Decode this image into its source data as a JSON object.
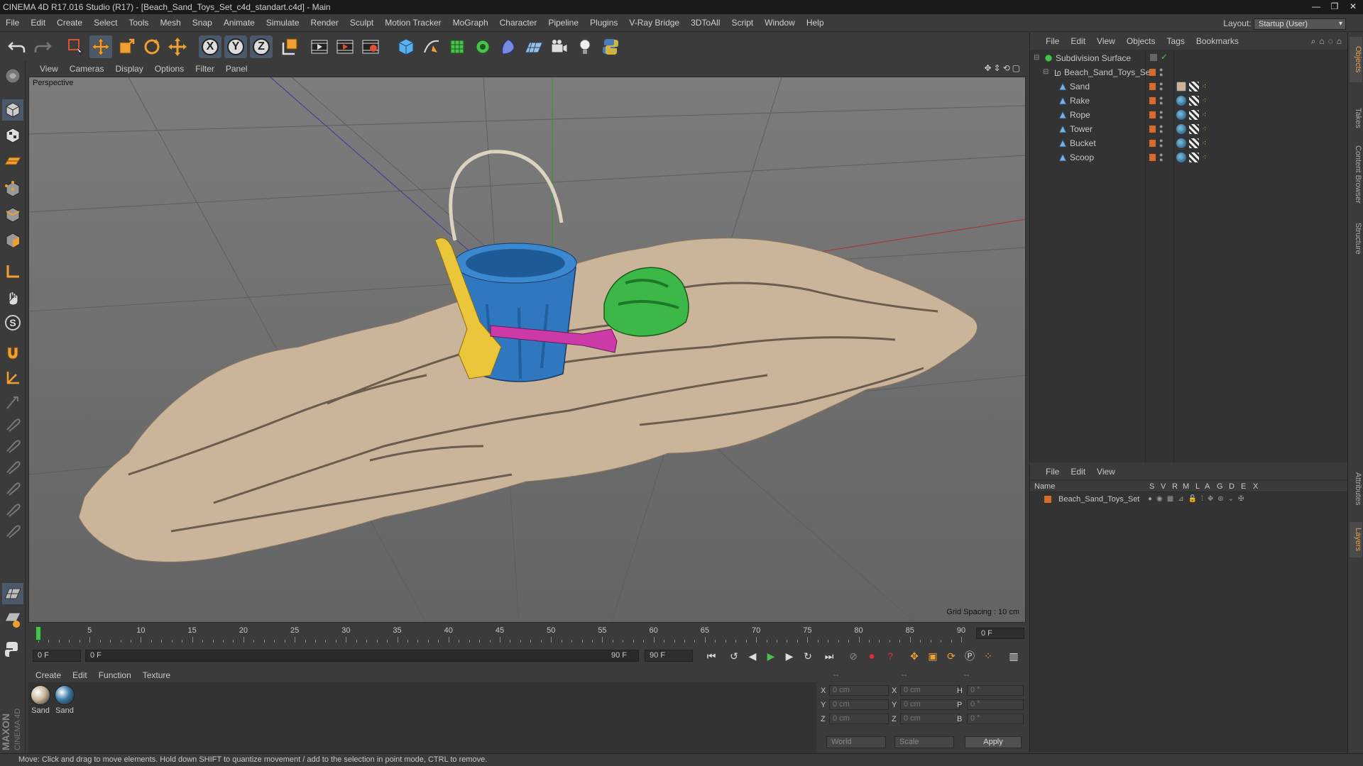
{
  "window": {
    "title": "CINEMA 4D R17.016 Studio (R17) - [Beach_Sand_Toys_Set_c4d_standart.c4d] - Main",
    "controls": [
      "—",
      "❐",
      "✕"
    ]
  },
  "menubar": {
    "items": [
      "File",
      "Edit",
      "Create",
      "Select",
      "Tools",
      "Mesh",
      "Snap",
      "Animate",
      "Simulate",
      "Render",
      "Sculpt",
      "Motion Tracker",
      "MoGraph",
      "Character",
      "Pipeline",
      "Plugins",
      "V-Ray Bridge",
      "3DToAll",
      "Script",
      "Window",
      "Help"
    ],
    "layout_label": "Layout:",
    "layout_value": "Startup (User)"
  },
  "toolbar": {
    "axis_x": "X",
    "axis_y": "Y",
    "axis_z": "Z"
  },
  "viewport": {
    "menu": [
      "View",
      "Cameras",
      "Display",
      "Options",
      "Filter",
      "Panel"
    ],
    "camera_label": "Perspective",
    "grid_spacing": "Grid Spacing : 10 cm"
  },
  "timeline": {
    "ticks": [
      "0",
      "5",
      "10",
      "15",
      "20",
      "25",
      "30",
      "35",
      "40",
      "45",
      "50",
      "55",
      "60",
      "65",
      "70",
      "75",
      "80",
      "85",
      "90"
    ],
    "current_frame": "0 F"
  },
  "transport": {
    "start_frame": "0 F",
    "range_start": "0 F",
    "range_end": "90 F",
    "end_frame": "90 F"
  },
  "materials": {
    "menu": [
      "Create",
      "Edit",
      "Function",
      "Texture"
    ],
    "items": [
      {
        "name": "Sand",
        "color": "#c9b59a"
      },
      {
        "name": "Sand",
        "color": "#3a7aa8"
      }
    ]
  },
  "coordinates": {
    "header": [
      "--",
      "--",
      "--"
    ],
    "rows": [
      {
        "l1": "X",
        "v1": "0 cm",
        "l2": "X",
        "v2": "0 cm",
        "l3": "H",
        "v3": "0 °"
      },
      {
        "l1": "Y",
        "v1": "0 cm",
        "l2": "Y",
        "v2": "0 cm",
        "l3": "P",
        "v3": "0 °"
      },
      {
        "l1": "Z",
        "v1": "0 cm",
        "l2": "Z",
        "v2": "0 cm",
        "l3": "B",
        "v3": "0 °"
      }
    ],
    "space": "World",
    "mode": "Scale",
    "apply_label": "Apply"
  },
  "object_manager": {
    "menu": [
      "File",
      "Edit",
      "View",
      "Objects",
      "Tags",
      "Bookmarks"
    ],
    "objects": [
      {
        "name": "Subdivision Surface",
        "indent": 0
      },
      {
        "name": "Beach_Sand_Toys_Set",
        "indent": 1
      },
      {
        "name": "Sand",
        "indent": 2
      },
      {
        "name": "Rake",
        "indent": 2
      },
      {
        "name": "Rope",
        "indent": 2
      },
      {
        "name": "Tower",
        "indent": 2
      },
      {
        "name": "Bucket",
        "indent": 2
      },
      {
        "name": "Scoop",
        "indent": 2
      }
    ]
  },
  "layer_manager": {
    "menu": [
      "File",
      "Edit",
      "View"
    ],
    "columns": [
      "Name",
      "S",
      "V",
      "R",
      "M",
      "L",
      "A",
      "G",
      "D",
      "E",
      "X"
    ],
    "layers": [
      {
        "name": "Beach_Sand_Toys_Set",
        "color": "#d86a2a"
      }
    ]
  },
  "side_tabs": [
    "Objects",
    "Takes",
    "Content Browser",
    "Structure",
    "Attributes",
    "Layers"
  ],
  "status": "Move: Click and drag to move elements. Hold down SHIFT to quantize movement / add to the selection in point mode, CTRL to remove.",
  "logo": {
    "line1": "MAXON",
    "line2": "CINEMA 4D"
  }
}
